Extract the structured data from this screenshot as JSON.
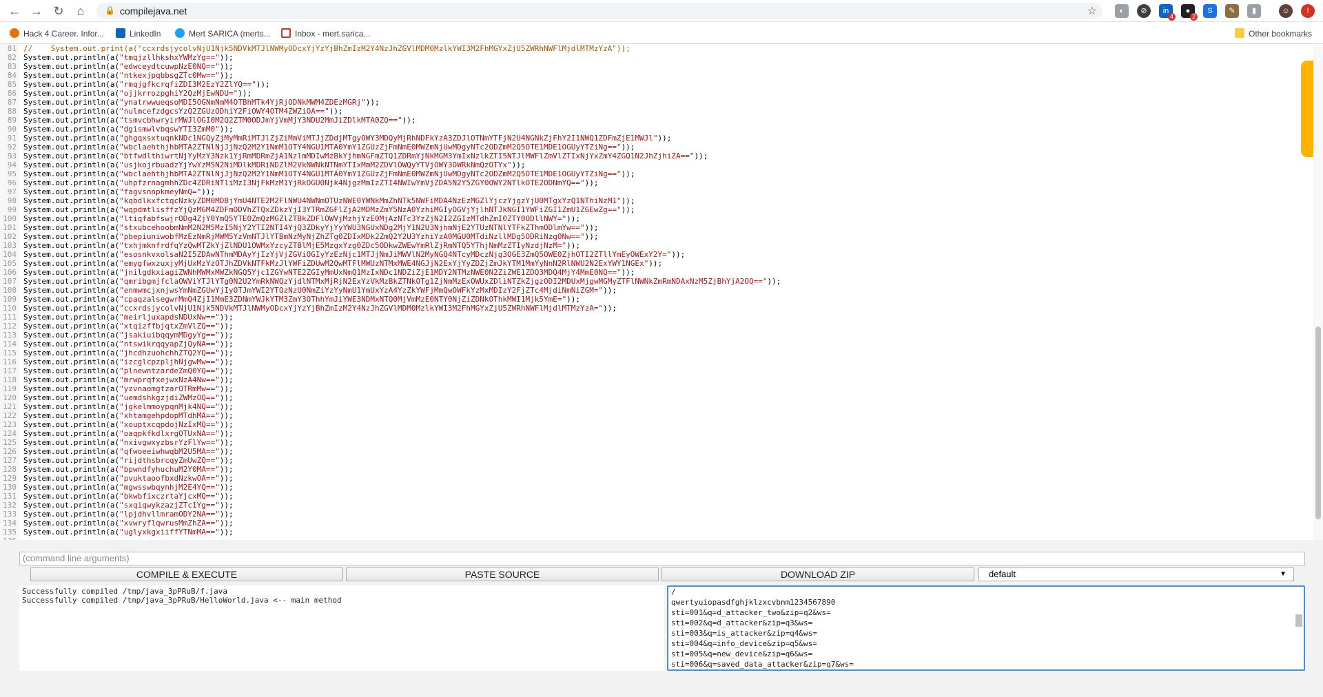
{
  "browser": {
    "url": "compilejava.net",
    "bookmarks": [
      "Hack 4 Career. Infor...",
      "LinkedIn",
      "Mert SARICA (merts...",
      "Inbox - mert.sarica..."
    ],
    "other_bookmarks": "Other bookmarks",
    "ext_badges": [
      "4",
      "2"
    ]
  },
  "editor": {
    "lines": [
      {
        "n": "81",
        "t": "//    System.out.print(a(\"ccxrdsjycolvNjU1Njk5NDVkMTJlNWMyODcxYjYzYjBhZmIzM2Y4NzJhZGVlMDM0MzlkYWI3M2FhMGYxZjU5ZWRhNWFlMjdlMTMzYzA\"));",
        "c": true
      },
      {
        "n": "82",
        "t": "System.out.println(a(\"tmqjzllhkshxYWMzYg==\"));"
      },
      {
        "n": "83",
        "t": "System.out.println(a(\"edwceydtcuwpNzE0NQ==\"));"
      },
      {
        "n": "84",
        "t": "System.out.println(a(\"ntkexjpqbbsgZTc0Mw==\"));"
      },
      {
        "n": "85",
        "t": "System.out.println(a(\"rmqjgfkcrqfiZDI3M2EzY2ZlYQ==\"));"
      },
      {
        "n": "86",
        "t": "System.out.println(a(\"ojjkrrozpghiY2QzMjEwNDU=\"));"
      },
      {
        "n": "87",
        "t": "System.out.println(a(\"ynatrwwueqsoMDI5OGNmNmM4OTBhMTk4YjRjODNkMWM4ZDEzMGRj\"));"
      },
      {
        "n": "88",
        "t": "System.out.println(a(\"nulmcefzdgcsYzQ2ZGUzODhiY2FiOWY4OTM4ZWZiOA==\"));"
      },
      {
        "n": "89",
        "t": "System.out.println(a(\"tsmvcbhwryirMWJlOGI0M2Q2ZTM0ODJmYjVmMjY3NDU2MmJiZDlkMTA0ZQ==\"));"
      },
      {
        "n": "90",
        "t": "System.out.println(a(\"dgismwlvbqswYTI3ZmM0\"));"
      },
      {
        "n": "91",
        "t": "System.out.println(a(\"ghgqxsxtuqnkNDc1NGQyZjMyMmRiMTJlZjZiMmViMTJjZDdjMTgyOWY3MDQyMjRhNDFkYzA3ZDJlOTNmYTFjN2U4NGNkZjFhY2I1NWQ1ZDFmZjE1MWJl\"));"
      },
      {
        "n": "92",
        "t": "System.out.println(a(\"wbclaehthjhbMTA2ZTNlNjJjNzQ2M2Y1NmM1OTY4NGU1MTA0YmY1ZGUzZjFmNmE0MWZmNjUwMDgyNTc2ODZmM2Q5OTE1MDE1OGUyYTZiNg==\"));"
      },
      {
        "n": "93",
        "t": "System.out.println(a(\"btfwdlthiwrtNjYyMzY3Nzk1YjRmMDRmZjA1NzlmMDIwMzBkYjhmNGFmZTQ1ZDRmYjNkMGM3YmIxNzlkZTI5NTJlMWFlZmVlZTIxNjYxZmY4ZGQ1N2JhZjhiZA==\"));"
      },
      {
        "n": "94",
        "t": "System.out.println(a(\"usjkojrbuadzYjYwYzM5N2NiMDlkMDRiNDZlM2VkNWNkNTNmYTIxMmM2ZDVlOWQyYTVjOWY3OWRkNmQzOTYx\"));"
      },
      {
        "n": "95",
        "t": "System.out.println(a(\"wbclaehthjhbMTA2ZTNlNjJjNzQ2M2Y1NmM1OTY4NGU1MTA0YmY1ZGUzZjFmNmE0MWZmNjUwMDgyNTc2ODZmM2Q5OTE1MDE1OGUyYTZiNg==\"));"
      },
      {
        "n": "96",
        "t": "System.out.println(a(\"uhpfzrnagmhhZDc4ZDRiNTliMzI3NjFkMzM1YjRkOGU0Njk4NjgzMmIzZTI4NWIwYmVjZDA5N2Y5ZGY0OWY2NTlkOTE2ODNmYQ==\"));"
      },
      {
        "n": "97",
        "t": "System.out.println(a(\"fagvsnnpkmeyNmQ=\"));"
      },
      {
        "n": "98",
        "t": "System.out.println(a(\"kqbdlkxfctqcNzkyZDM0MDBjYmU4NTE2M2FlNWU4NWNmOTUzNWE0YWNkMmZhNTk5NWFiMDA4NzEzMGZlYjczYjgzYjU0MTgxYzQ1NThiNzM1\"));"
      },
      {
        "n": "99",
        "t": "System.out.println(a(\"wqpdmtlisffzYjQzMGM4ZDFmODVhZTQxZDkzYjI3YTRmZGFlZjA2MDMzZmY5NzA0YzhiMGIyOGVjYjlhNTJkNGI1YWFiZGI1ZmU1ZGEwZg==\"));"
      },
      {
        "n": "100",
        "t": "System.out.println(a(\"ltiqfabfswjrODg4ZjY0YmQ5YTE0ZmQzMGZlZTBkZDFlOWVjMzhjYzE0MjAzNTc3YzZjN2I2ZGIzMTdhZmI0ZTY0ODllNWY=\"));"
      },
      {
        "n": "101",
        "t": "System.out.println(a(\"stxubcehoobmNmM2N2M5MzI5NjY2YTI2NTI4YjQ3ZDkyYjYyYWU3NGUxNDg2MjY1N2U3NjhmNjE2YTUzNTNlYTFkZThmODlmYw==\"));"
      },
      {
        "n": "102",
        "t": "System.out.println(a(\"pbepiuniwobfMzEzNmRjMWM5YzVmNTJlYTBmNzMyNjZhZTg0ZDIxMDk2ZmQ2Y2U3YzhiYzA0MGU0MTdiNzllMDg5ODRiNzg0Nw==\"));"
      },
      {
        "n": "103",
        "t": "System.out.println(a(\"txhjmknfrdfqYzQwMTZkYjZlNDU1OWMxYzcyZTBlMjE5MzgxYzg0ZDc5ODkwZWEwYmRlZjRmNTQ5YThjNmMzZTIyNzdjNzM=\"));"
      },
      {
        "n": "104",
        "t": "System.out.println(a(\"esosnkvxolsaN2I5ZDAwNThmMDAyYjIzYjVjZGViOGIyYzEzNjc1MTJjNmJiMWVlN2MyNGQ4NTcyMDczNjg3OGE3ZmQ5OWE0ZjhOTI2ZTllYmEyOWExY2Y=\"));"
      },
      {
        "n": "105",
        "t": "System.out.println(a(\"emygfwxzuxjyMjUxMzYzOTJhZDVkNTFkMzJlYWFiZDUwM2QwMTFlMWUzNTMxMWE4NGJjN2ExYjYyZDZjZmJkYTM1MmYyNnN2RlNWU2N2ExYWY1NGEx\"));"
      },
      {
        "n": "106",
        "t": "System.out.println(a(\"jnilgdkxiagiZWNhMWMxMWZkNGQ5Yjc1ZGYwNTE2ZGIyMmUxNmQ1MzIxNDc1NDZiZjE1MDY2NTMzNWE0N2ZiZWE1ZDQ3MDQ4MjY4MmE0NQ==\"));"
      },
      {
        "n": "107",
        "t": "System.out.println(a(\"qmribgmjfclaOWViYTJlYTg0N2U2YmRkNWQzYjdlNTMxMjRjN2ExYzVkMzBkZTNkOTg1ZjNmMzExOWUxZDliNTZkZjgzODI2MDUxMjgwMGMyZTFlNWNkZmRmNDAxNzM5ZjBhYjA2OQ==\"));"
      },
      {
        "n": "108",
        "t": "System.out.println(a(\"enmwmcjxnjwsYmNmZGUwYjIyOTJmYWI2YTQzNzU0NmZiYzYyNmU1YmUxYzA4YzZkYWFjMmQwOWFkYzMxMDIzY2FjZTc4MjdiNmNiZGM=\"));"
      },
      {
        "n": "109",
        "t": "System.out.println(a(\"cpaqzalsegwrMmQ4ZjI1MmE3ZDNmYWJkYTM3ZmY3OThhYmJiYWE3NDMxNTQ0MjVmMzE0NTY0NjZiZDNkOThkMWI1Mjk5YmE=\"));"
      },
      {
        "n": "110",
        "t": "System.out.println(a(\"ccxrdsjycolvNjU1Njk5NDVkMTJlNWMyODcxYjYzYjBhZmIzM2Y4NzJhZGVlMDM0MzlkYWI3M2FhMGYxZjU5ZWRhNWFlMjdlMTMzYzA=\"));"
      },
      {
        "n": "111",
        "t": "System.out.println(a(\"meirljuxapdsNDUxNw==\"));"
      },
      {
        "n": "112",
        "t": "System.out.println(a(\"xtqizffbjqtxZmVlZQ==\"));"
      },
      {
        "n": "113",
        "t": "System.out.println(a(\"jsakiuibqqymMDgyYg==\"));"
      },
      {
        "n": "114",
        "t": "System.out.println(a(\"ntswikrqqyapZjQyNA==\"));"
      },
      {
        "n": "115",
        "t": "System.out.println(a(\"jhcdhzuohchhZTQ2YQ==\"));"
      },
      {
        "n": "116",
        "t": "System.out.println(a(\"izcglcpzpljhNjgwMw==\"));"
      },
      {
        "n": "117",
        "t": "System.out.println(a(\"plnewntzardeZmQ0YQ==\"));"
      },
      {
        "n": "118",
        "t": "System.out.println(a(\"mrwprqfxejwxNzA4Nw==\"));"
      },
      {
        "n": "119",
        "t": "System.out.println(a(\"yzvnaomgtzarOTRmMw==\"));"
      },
      {
        "n": "120",
        "t": "System.out.println(a(\"uemdshkgzjdiZWMzOQ==\"));"
      },
      {
        "n": "121",
        "t": "System.out.println(a(\"jgkelmmoypqnMjk4NQ==\"));"
      },
      {
        "n": "122",
        "t": "System.out.println(a(\"xhtamgehpdopMTdhMA==\"));"
      },
      {
        "n": "123",
        "t": "System.out.println(a(\"xouptxcqpdojNzIxMQ==\"));"
      },
      {
        "n": "124",
        "t": "System.out.println(a(\"oaqpkfkdlxrgOTUxNA==\"));"
      },
      {
        "n": "125",
        "t": "System.out.println(a(\"nxivgwxyzbsrYzFlYw==\"));"
      },
      {
        "n": "126",
        "t": "System.out.println(a(\"qfwoeeiwhwqbM2U5MA==\"));"
      },
      {
        "n": "127",
        "t": "System.out.println(a(\"rijdthsbrcqyZmUwZQ==\"));"
      },
      {
        "n": "128",
        "t": "System.out.println(a(\"bpwndfyhuchuM2Y0MA==\"));"
      },
      {
        "n": "129",
        "t": "System.out.println(a(\"pvuktaoofbxdNzkwOA==\"));"
      },
      {
        "n": "130",
        "t": "System.out.println(a(\"mgwsswbqynhjM2E4YQ==\"));"
      },
      {
        "n": "131",
        "t": "System.out.println(a(\"bkwbfixczrtaYjcxMQ==\"));"
      },
      {
        "n": "132",
        "t": "System.out.println(a(\"sxqiqwykzazjZTc1Yg==\"));"
      },
      {
        "n": "133",
        "t": "System.out.println(a(\"lpjdhvllmramODY2NA==\"));"
      },
      {
        "n": "134",
        "t": "System.out.println(a(\"xvwryflqwrusMmZhZA==\"));"
      },
      {
        "n": "135",
        "t": "System.out.println(a(\"uglyxkgxiiffYTNmMA==\"));"
      },
      {
        "n": "136",
        "t": ""
      }
    ]
  },
  "controls": {
    "args_placeholder": "(command line arguments)",
    "compile_label": "COMPILE & EXECUTE",
    "paste_label": "PASTE SOURCE",
    "download_label": "DOWNLOAD ZIP",
    "select_value": "default"
  },
  "output": {
    "text": "Successfully compiled /tmp/java_3pPRuB/f.java\nSuccessfully compiled /tmp/java_3pPRuB/HelloWorld.java <-- main method"
  },
  "stdin": {
    "text": "/\nqwertyuiopasdfghjklzxcvbnm1234567890\nsti=001&q=d_attacker_two&zip=q2&ws=\nsti=002&q=d_attacker&zip=q3&ws=\nsti=003&q=is_attacker&zip=q4&ws=\nsti=004&q=info_device&zip=q5&ws=\nsti=005&q=new_device&zip=q6&ws=\nsti=006&q=saved_data_attacker&zip=q7&ws="
  }
}
